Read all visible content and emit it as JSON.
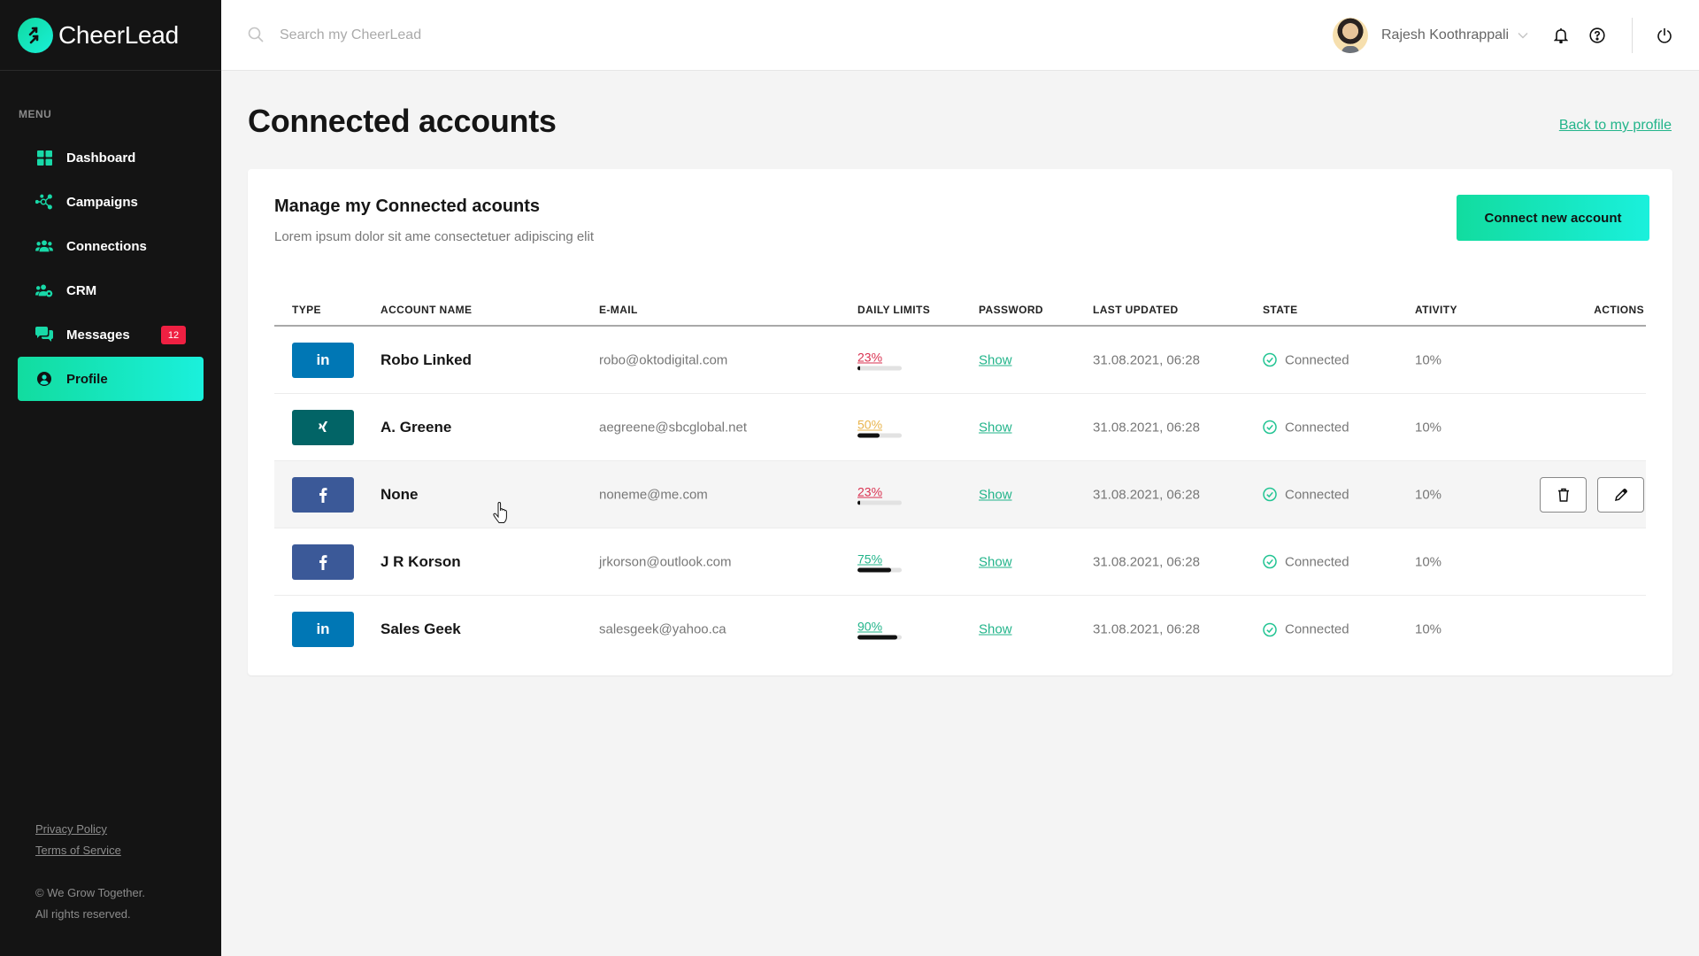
{
  "app": {
    "name": "CheerLead"
  },
  "sidebar": {
    "menu_label": "MENU",
    "items": [
      {
        "label": "Dashboard",
        "icon": "dashboard-grid-icon"
      },
      {
        "label": "Campaigns",
        "icon": "campaigns-network-icon"
      },
      {
        "label": "Connections",
        "icon": "connections-users-icon"
      },
      {
        "label": "CRM",
        "icon": "crm-users-gear-icon"
      },
      {
        "label": "Messages",
        "icon": "messages-chat-icon",
        "badge": "12"
      },
      {
        "label": "Profile",
        "icon": "profile-user-icon",
        "active": true
      }
    ],
    "footer": {
      "privacy": "Privacy Policy",
      "terms": "Terms of Service",
      "copyright_line1": "© We Grow Together.",
      "copyright_line2": "All rights reserved."
    }
  },
  "header": {
    "search_placeholder": "Search my CheerLead",
    "search_value": "",
    "user_name": "Rajesh Koothrappali"
  },
  "page": {
    "title": "Connected accounts",
    "back_link": "Back to my profile"
  },
  "card": {
    "title": "Manage my Connected acounts",
    "subtitle": "Lorem ipsum dolor sit ame consectetuer adipiscing elit",
    "connect_button": "Connect new account"
  },
  "table": {
    "columns": [
      "TYPE",
      "ACCOUNT NAME",
      "E-MAIL",
      "DAILY LIMITS",
      "PASSWORD",
      "LAST UPDATED",
      "STATE",
      "ATIVITY",
      "ACTIONS"
    ],
    "rows": [
      {
        "type": "linkedin",
        "type_glyph": "in",
        "name": "Robo Linked",
        "email": "robo@oktodigital.com",
        "daily_limit": "23%",
        "daily_limit_value": 0.05,
        "limit_color": "#d9304f",
        "password": "Show",
        "last_updated": "31.08.2021, 06:28",
        "state": "Connected",
        "activity": "10%"
      },
      {
        "type": "xing",
        "type_glyph": "x",
        "name": "A. Greene",
        "email": "aegreene@sbcglobal.net",
        "daily_limit": "50%",
        "daily_limit_value": 0.5,
        "limit_color": "#e9b44c",
        "password": "Show",
        "last_updated": "31.08.2021, 06:28",
        "state": "Connected",
        "activity": "10%"
      },
      {
        "type": "facebook",
        "type_glyph": "f",
        "name": "None",
        "email": "noneme@me.com",
        "daily_limit": "23%",
        "daily_limit_value": 0.05,
        "limit_color": "#d9304f",
        "password": "Show",
        "last_updated": "31.08.2021, 06:28",
        "state": "Connected",
        "activity": "10%",
        "hovered": true
      },
      {
        "type": "facebook",
        "type_glyph": "f",
        "name": "J R Korson",
        "email": "jrkorson@outlook.com",
        "daily_limit": "75%",
        "daily_limit_value": 0.75,
        "limit_color": "#22b48a",
        "password": "Show",
        "last_updated": "31.08.2021, 06:28",
        "state": "Connected",
        "activity": "10%"
      },
      {
        "type": "linkedin",
        "type_glyph": "in",
        "name": "Sales Geek",
        "email": "salesgeek@yahoo.ca",
        "daily_limit": "90%",
        "daily_limit_value": 0.9,
        "limit_color": "#22b48a",
        "password": "Show",
        "last_updated": "31.08.2021, 06:28",
        "state": "Connected",
        "activity": "10%"
      }
    ]
  },
  "colors": {
    "accent": "#12dc9f",
    "accent_end": "#1af0dc",
    "linkedin": "#0077b5",
    "xing": "#026466",
    "facebook": "#3b5998",
    "badge": "#ef2042",
    "link": "#22b48a",
    "sidebar_bg": "#141414"
  }
}
